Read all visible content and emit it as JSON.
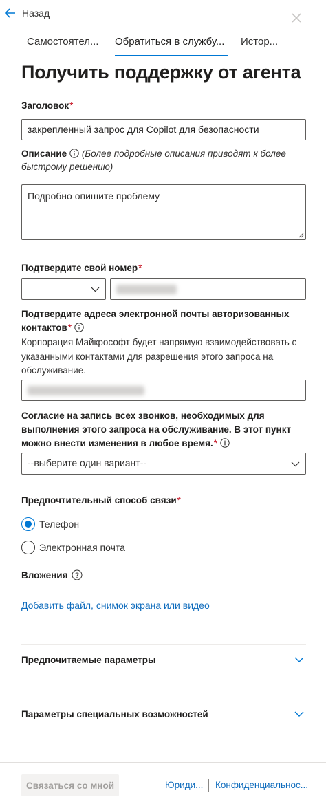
{
  "header": {
    "back_label": "Назад",
    "back_icon": "arrow-left-icon",
    "close_icon": "close-icon"
  },
  "tabs": [
    {
      "label": "Самостоятел...",
      "active": false
    },
    {
      "label": "Обратиться в службу...",
      "active": true
    },
    {
      "label": "Истор...",
      "active": false
    }
  ],
  "page_title": "Получить поддержку от агента",
  "form": {
    "title_label": "Заголовок",
    "title_value": "закрепленный запрос для Copilot для безопасности",
    "description_label": "Описание",
    "description_hint": "(Более подробные описания приводят к более быстрому решению)",
    "description_placeholder": "Подробно опишите проблему",
    "phone_label": "Подтвердите свой номер",
    "email_label": "Подтвердите адреса электронной почты авторизованных контактов",
    "email_desc": "Корпорация Майкрософт будет напрямую взаимодействовать с указанными контактами для разрешения этого запроса на обслуживание.",
    "consent_label": "Согласие на запись всех звонков, необходимых для выполнения этого запроса на обслуживание. В этот пункт можно внести изменения в любое время.",
    "consent_value": "--выберите один вариант--",
    "contact_label": "Предпочтительный способ связи",
    "contact_options": [
      {
        "label": "Телефон",
        "checked": true
      },
      {
        "label": "Электронная почта",
        "checked": false
      }
    ],
    "attachments_label": "Вложения",
    "attachments_link": "Добавить файл, снимок экрана или видео",
    "required_mark": "*"
  },
  "accordions": [
    {
      "label": "Предпочитаемые параметры",
      "expanded": false
    },
    {
      "label": "Параметры специальных возможностей",
      "expanded": false
    }
  ],
  "footer": {
    "contact_button": "Связаться со мной",
    "link_legal": "Юриди...",
    "link_privacy": "Конфиденциальнос..."
  },
  "colors": {
    "accent": "#0078d4",
    "link": "#0f6cbd",
    "required": "#c50f1f"
  }
}
